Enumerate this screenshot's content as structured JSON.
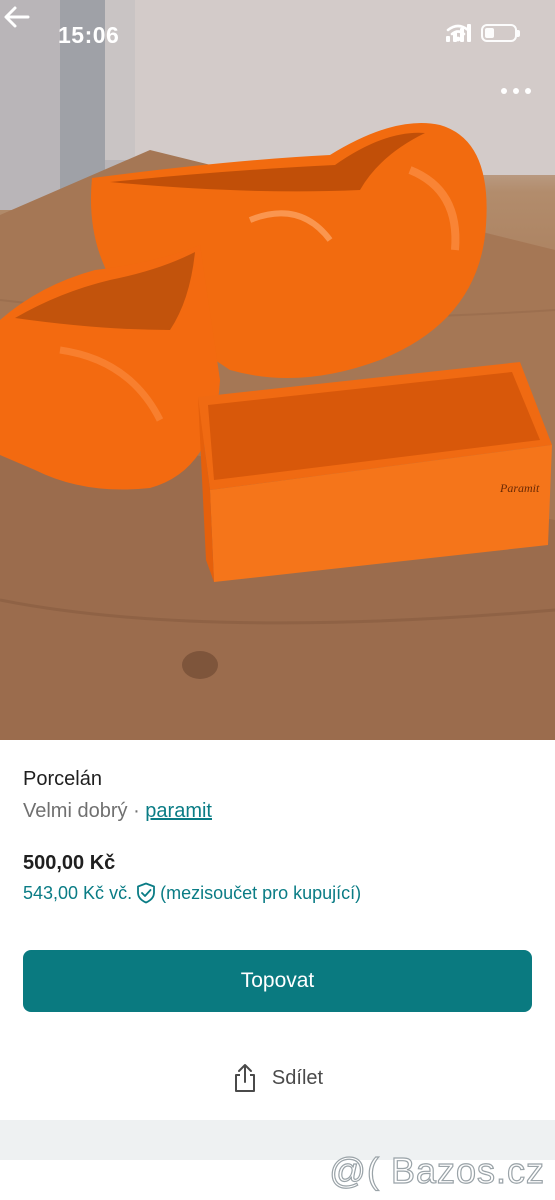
{
  "status_bar": {
    "time": "15:06"
  },
  "photo": {
    "description_icon": "product-photo",
    "colors": {
      "vase": "#f26b0f",
      "table": "#a87a58"
    }
  },
  "listing": {
    "title": "Porcelán",
    "condition": "Velmi dobrý",
    "separator": "·",
    "seller": "paramit",
    "price": "500,00 Kč",
    "price_total": "543,00 Kč vč.",
    "price_note": "(mezisoučet pro kupující)"
  },
  "actions": {
    "primary_label": "Topovat",
    "share_label": "Sdílet"
  },
  "watermark": "@( Bazos.cz",
  "colors": {
    "accent": "#0a7a80",
    "link": "#0a7c85",
    "text": "#1f1f1f",
    "muted": "#707070"
  }
}
